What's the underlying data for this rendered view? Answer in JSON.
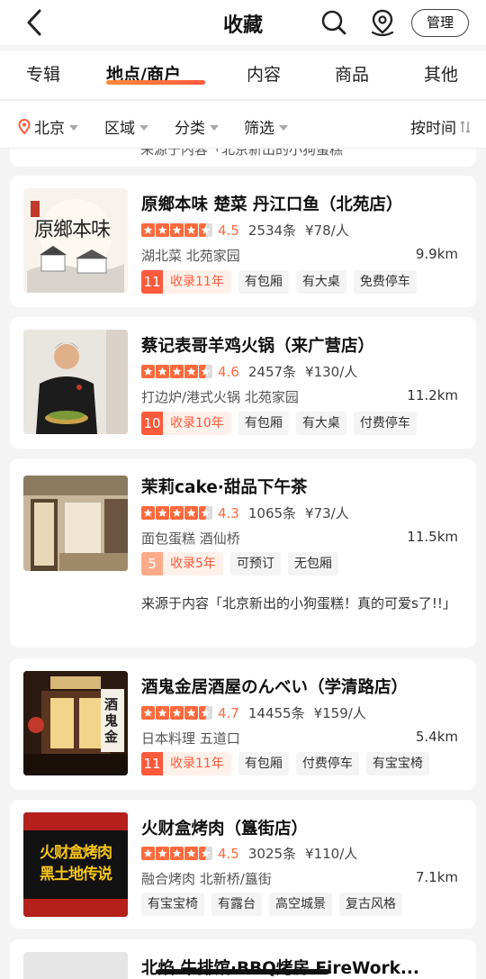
{
  "header": {
    "title": "收藏",
    "manage_label": "管理"
  },
  "tabs": [
    {
      "label": "专辑",
      "active": false
    },
    {
      "label": "地点/商户",
      "active": true
    },
    {
      "label": "内容",
      "active": false
    },
    {
      "label": "商品",
      "active": false
    },
    {
      "label": "其他",
      "active": false
    }
  ],
  "filters": {
    "city": "北京",
    "region": "区域",
    "category": "分类",
    "screen": "筛选",
    "sort": "按时间"
  },
  "previous_item_fragment": "来源于内容「北京新出的小狗蛋糕",
  "places": [
    {
      "name": "原鄉本味 楚菜 丹江口鱼（北苑店）",
      "rating": 4.5,
      "score": "4.5",
      "reviews": "2534条",
      "price": "¥78/人",
      "category": "湖北菜 北苑家园",
      "distance": "9.9km",
      "record_num": "11",
      "record_text": "收录11年",
      "tags": [
        "有包厢",
        "有大桌",
        "免费停车"
      ],
      "thumb_text": "原鄉本味"
    },
    {
      "name": "蔡记表哥羊鸡火锅（来广营店）",
      "rating": 4.6,
      "score": "4.6",
      "reviews": "2457条",
      "price": "¥130/人",
      "category": "打边炉/港式火锅 北苑家园",
      "distance": "11.2km",
      "record_num": "10",
      "record_text": "收录10年",
      "tags": [
        "有包厢",
        "有大桌",
        "付费停车"
      ]
    },
    {
      "name": "茉莉cake·甜品下午茶",
      "rating": 4.3,
      "score": "4.3",
      "reviews": "1065条",
      "price": "¥73/人",
      "category": "面包蛋糕 酒仙桥",
      "distance": "11.5km",
      "record_num": "5",
      "record_text": "收录5年",
      "tags": [
        "可预订",
        "无包厢"
      ],
      "source": "来源于内容「北京新出的小狗蛋糕！真的可爱s了!!」"
    },
    {
      "name": "酒鬼金居酒屋のんべい（学清路店）",
      "rating": 4.7,
      "score": "4.7",
      "reviews": "14455条",
      "price": "¥159/人",
      "category": "日本料理 五道口",
      "distance": "5.4km",
      "record_num": "11",
      "record_text": "收录11年",
      "tags": [
        "有包厢",
        "付费停车",
        "有宝宝椅"
      ],
      "thumb_text": "酒鬼金"
    },
    {
      "name": "火财盒烤肉（簋街店）",
      "rating": 4.5,
      "score": "4.5",
      "reviews": "3025条",
      "price": "¥110/人",
      "category": "融合烤肉 北新桥/簋街",
      "distance": "7.1km",
      "tags": [
        "有宝宝椅",
        "有露台",
        "高空城景",
        "复古风格"
      ],
      "thumb_text": "火财盒烤肉",
      "thumb_text2": "黑土地传说"
    },
    {
      "name": "北焰 牛排馆·BBQ烤房 FireWork..."
    }
  ],
  "colors": {
    "accent": "#ff5a3c",
    "star": "#ff6a3d",
    "background": "#f4f4f4"
  }
}
